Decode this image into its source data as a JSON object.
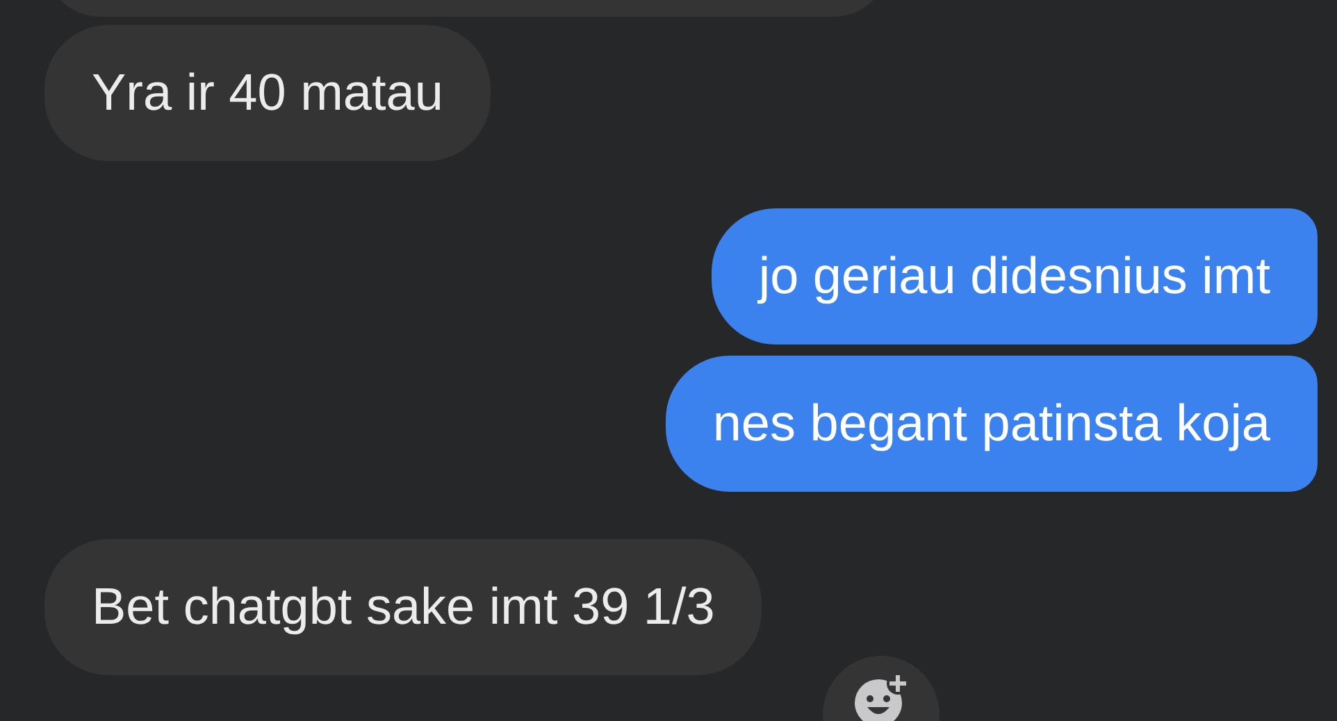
{
  "messages": [
    {
      "kind": "incoming",
      "text": "Yra ir 40 matau"
    },
    {
      "kind": "outgoing",
      "text": "jo geriau didesnius imt"
    },
    {
      "kind": "outgoing",
      "text": "nes begant patinsta koja"
    },
    {
      "kind": "incoming",
      "text": "Bet chatgbt sake imt 39 1/3"
    }
  ]
}
